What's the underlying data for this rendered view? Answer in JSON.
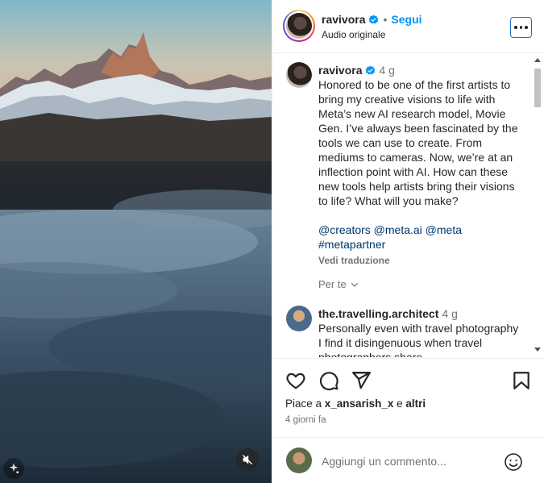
{
  "media": {
    "mute_icon": "speaker-muted-icon",
    "ai_badge_icon": "ai-sparkle-icon"
  },
  "header": {
    "username": "ravivora",
    "separator": "•",
    "follow_label": "Segui",
    "subtitle": "Audio originale",
    "more_icon": "more-dots-icon"
  },
  "caption": {
    "username": "ravivora",
    "time": "4 g",
    "text": "Honored to be one of the first artists to bring my creative visions to life with Meta’s new AI research model, Movie Gen. I’ve always been fascinated by the tools we can use to create. From mediums to cameras. Now, we’re at an inflection point with AI. How can these new tools help artists bring their visions to life? What will you make?",
    "mentions_line1": "@creators @meta.ai @meta",
    "mentions_line2": "#metapartner",
    "translate_label": "Vedi traduzione",
    "replies_label": "Per te"
  },
  "comments": [
    {
      "username": "the.travelling.architect",
      "time": "4 g",
      "text": "Personally even with travel photography I find it disingenuous when travel photographers share"
    }
  ],
  "actions": {
    "like_icon": "heart-icon",
    "comment_icon": "comment-bubble-icon",
    "share_icon": "paper-plane-icon",
    "save_icon": "bookmark-icon",
    "likes_prefix": "Piace a ",
    "likes_user": "x_ansarish_x",
    "likes_suffix": " e ",
    "likes_others": "altri",
    "date": "4 giorni fa"
  },
  "composer": {
    "placeholder": "Aggiungi un commento...",
    "emoji_icon": "emoji-smile-icon"
  },
  "colors": {
    "accent": "#0095f6",
    "text": "#262626",
    "muted": "#737373",
    "mention": "#00376b"
  }
}
